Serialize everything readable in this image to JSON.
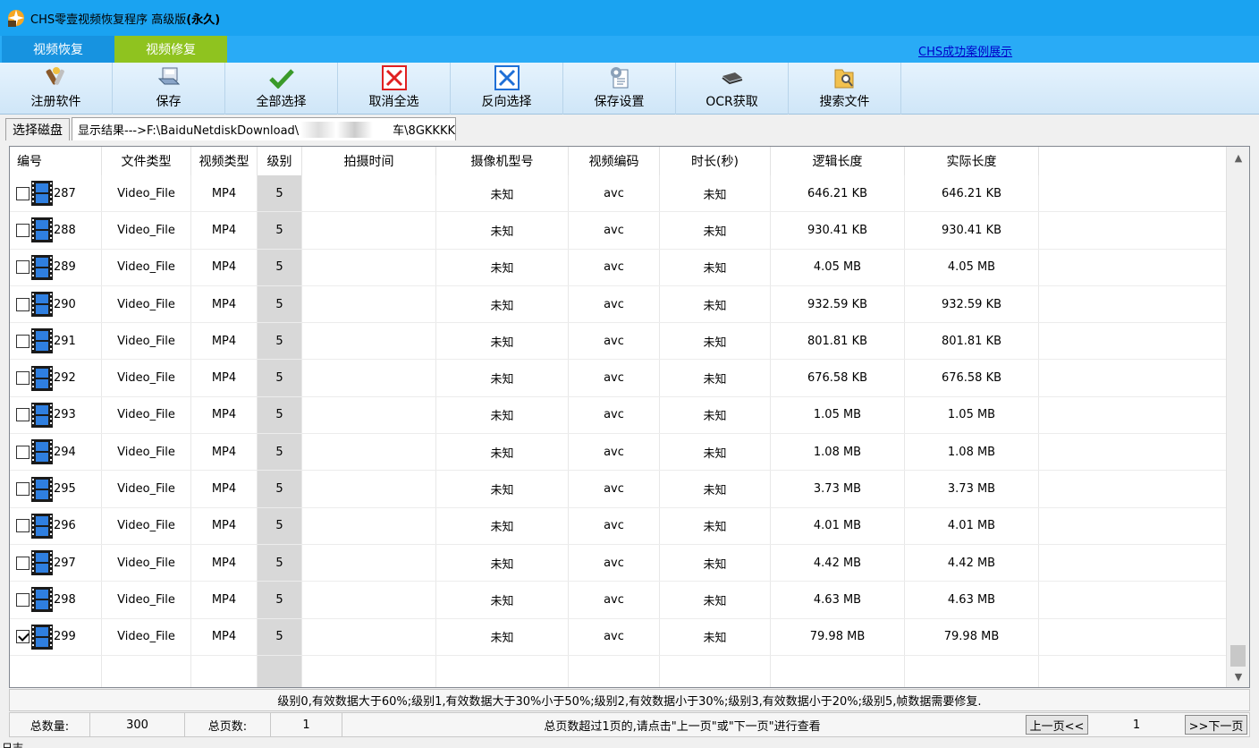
{
  "window": {
    "title_prefix": "CHS零壹视频恢复程序 高级版",
    "title_suffix": "(永久)"
  },
  "tabs": [
    {
      "label": "视频恢复",
      "active": false
    },
    {
      "label": "视频修复",
      "active": true
    }
  ],
  "case_link": "CHS成功案例展示",
  "toolbar": {
    "register": "注册软件",
    "save": "保存",
    "select_all": "全部选择",
    "cancel_all": "取消全选",
    "invert": "反向选择",
    "save_settings": "保存设置",
    "ocr": "OCR获取",
    "search_file": "搜索文件"
  },
  "pathbar": {
    "select_disk": "选择磁盘",
    "result_prefix": "显示结果--->F:\\BaiduNetdiskDownload\\",
    "result_suffix": "车\\8GKKKK"
  },
  "table": {
    "headers": [
      "编号",
      "文件类型",
      "视频类型",
      "级别",
      "拍摄时间",
      "摄像机型号",
      "视频编码",
      "时长(秒)",
      "逻辑长度",
      "实际长度"
    ],
    "rows": [
      {
        "id": "287",
        "type": "Video_File",
        "vtype": "MP4",
        "level": "5",
        "time": "",
        "camera": "未知",
        "codec": "avc",
        "duration": "未知",
        "logical": "646.21 KB",
        "actual": "646.21 KB",
        "checked": false
      },
      {
        "id": "288",
        "type": "Video_File",
        "vtype": "MP4",
        "level": "5",
        "time": "",
        "camera": "未知",
        "codec": "avc",
        "duration": "未知",
        "logical": "930.41 KB",
        "actual": "930.41 KB",
        "checked": false
      },
      {
        "id": "289",
        "type": "Video_File",
        "vtype": "MP4",
        "level": "5",
        "time": "",
        "camera": "未知",
        "codec": "avc",
        "duration": "未知",
        "logical": "4.05 MB",
        "actual": "4.05 MB",
        "checked": false
      },
      {
        "id": "290",
        "type": "Video_File",
        "vtype": "MP4",
        "level": "5",
        "time": "",
        "camera": "未知",
        "codec": "avc",
        "duration": "未知",
        "logical": "932.59 KB",
        "actual": "932.59 KB",
        "checked": false
      },
      {
        "id": "291",
        "type": "Video_File",
        "vtype": "MP4",
        "level": "5",
        "time": "",
        "camera": "未知",
        "codec": "avc",
        "duration": "未知",
        "logical": "801.81 KB",
        "actual": "801.81 KB",
        "checked": false
      },
      {
        "id": "292",
        "type": "Video_File",
        "vtype": "MP4",
        "level": "5",
        "time": "",
        "camera": "未知",
        "codec": "avc",
        "duration": "未知",
        "logical": "676.58 KB",
        "actual": "676.58 KB",
        "checked": false
      },
      {
        "id": "293",
        "type": "Video_File",
        "vtype": "MP4",
        "level": "5",
        "time": "",
        "camera": "未知",
        "codec": "avc",
        "duration": "未知",
        "logical": "1.05 MB",
        "actual": "1.05 MB",
        "checked": false
      },
      {
        "id": "294",
        "type": "Video_File",
        "vtype": "MP4",
        "level": "5",
        "time": "",
        "camera": "未知",
        "codec": "avc",
        "duration": "未知",
        "logical": "1.08 MB",
        "actual": "1.08 MB",
        "checked": false
      },
      {
        "id": "295",
        "type": "Video_File",
        "vtype": "MP4",
        "level": "5",
        "time": "",
        "camera": "未知",
        "codec": "avc",
        "duration": "未知",
        "logical": "3.73 MB",
        "actual": "3.73 MB",
        "checked": false
      },
      {
        "id": "296",
        "type": "Video_File",
        "vtype": "MP4",
        "level": "5",
        "time": "",
        "camera": "未知",
        "codec": "avc",
        "duration": "未知",
        "logical": "4.01 MB",
        "actual": "4.01 MB",
        "checked": false
      },
      {
        "id": "297",
        "type": "Video_File",
        "vtype": "MP4",
        "level": "5",
        "time": "",
        "camera": "未知",
        "codec": "avc",
        "duration": "未知",
        "logical": "4.42 MB",
        "actual": "4.42 MB",
        "checked": false
      },
      {
        "id": "298",
        "type": "Video_File",
        "vtype": "MP4",
        "level": "5",
        "time": "",
        "camera": "未知",
        "codec": "avc",
        "duration": "未知",
        "logical": "4.63 MB",
        "actual": "4.63 MB",
        "checked": false
      },
      {
        "id": "299",
        "type": "Video_File",
        "vtype": "MP4",
        "level": "5",
        "time": "",
        "camera": "未知",
        "codec": "avc",
        "duration": "未知",
        "logical": "79.98 MB",
        "actual": "79.98 MB",
        "checked": true
      }
    ]
  },
  "legend": "级别0,有效数据大于60%;级别1,有效数据大于30%小于50%;级别2,有效数据小于30%;级别3,有效数据小于20%;级别5,帧数据需要修复.",
  "footer": {
    "total_label": "总数量:",
    "total_value": "300",
    "pages_label": "总页数:",
    "pages_value": "1",
    "hint": "总页数超过1页的,请点击\"上一页\"或\"下一页\"进行查看",
    "prev": "上一页<<",
    "current_page": "1",
    "next": ">>下一页"
  },
  "status": "日志",
  "colors": {
    "titlebar": "#1aa3f1",
    "tab_active": "#8fc31f",
    "tab_inactive": "#1793e0"
  }
}
